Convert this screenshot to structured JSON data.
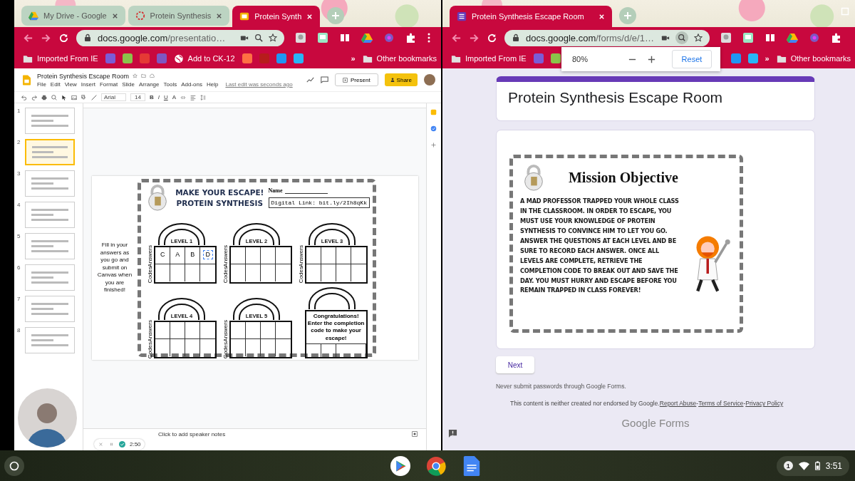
{
  "left_window": {
    "tabs": [
      {
        "title": "My Drive - Google",
        "selected": false
      },
      {
        "title": "Protein Synthesis",
        "selected": false
      },
      {
        "title": "Protein Synth",
        "selected": true
      }
    ],
    "url": {
      "host": "docs.google.com",
      "path": "/presentatio…"
    },
    "bookmarks": [
      {
        "kind": "folder",
        "label": "Imported From IE"
      },
      {
        "kind": "icon",
        "color": "#7b5cd6"
      },
      {
        "kind": "icon",
        "color": "#8bc34a"
      },
      {
        "kind": "icon",
        "color": "#e53935"
      },
      {
        "kind": "icon",
        "color": "#7e57c2"
      },
      {
        "kind": "globe",
        "label": "Add to CK-12"
      },
      {
        "kind": "icon",
        "color": "#ff7043"
      },
      {
        "kind": "icon",
        "color": "#b71c1c"
      },
      {
        "kind": "icon",
        "color": "#2196f3"
      },
      {
        "kind": "icon",
        "color": "#29b6f6"
      }
    ],
    "bookmarks_end": [
      {
        "kind": "overflow",
        "label": "»"
      },
      {
        "kind": "folder",
        "label": "Other bookmarks"
      }
    ]
  },
  "slides_app": {
    "doc_title": "Protein Synthesis Escape Room",
    "menus": [
      "File",
      "Edit",
      "View",
      "Insert",
      "Format",
      "Slide",
      "Arrange",
      "Tools",
      "Add-ons",
      "Help"
    ],
    "last_edit": "Last edit was seconds ago",
    "present": "Present",
    "share": "Share",
    "font": "Arial",
    "font_size": "14",
    "format_buttons": [
      "B",
      "I",
      "U",
      "A"
    ],
    "thumbnails": [
      {
        "number": "1",
        "selected": false
      },
      {
        "number": "2",
        "selected": true
      },
      {
        "number": "3",
        "selected": false
      },
      {
        "number": "4",
        "selected": false
      },
      {
        "number": "5",
        "selected": false
      },
      {
        "number": "6",
        "selected": false
      },
      {
        "number": "7",
        "selected": false
      },
      {
        "number": "8",
        "selected": false
      }
    ],
    "slide": {
      "side_note": "Fill in your answers as you go and submit on Canvas when you are finished!",
      "title_1": "MAKE YOUR ESCAPE!",
      "title_2": "PROTEIN SYNTHESIS",
      "name_label": "Name",
      "digital_link": "Digital Link: bit.ly/2Ih8qKk",
      "locks": [
        {
          "kind": "level",
          "title": "LEVEL 1",
          "row_labels": [
            "Answers",
            "Codes"
          ],
          "answers": [
            {
              "text": "C",
              "selected": false
            },
            {
              "text": "A",
              "selected": false
            },
            {
              "text": "B",
              "selected": false
            },
            {
              "text": "D",
              "selected": true
            }
          ]
        },
        {
          "kind": "level",
          "title": "LEVEL 2",
          "row_labels": [
            "Answers",
            "Codes"
          ]
        },
        {
          "kind": "level",
          "title": "LEVEL 3",
          "row_labels": [
            "Answers",
            "Codes"
          ]
        },
        {
          "kind": "level",
          "title": "LEVEL 4",
          "row_labels": [
            "Answers",
            "Codes"
          ]
        },
        {
          "kind": "level",
          "title": "LEVEL 5",
          "row_labels": [
            "Answers",
            "Codes"
          ]
        },
        {
          "kind": "final",
          "message": "Congratulations! Enter the completion code to make your escape!"
        }
      ]
    },
    "speaker_notes": "Click to add speaker notes"
  },
  "recording": {
    "timer": "2:50"
  },
  "right_window": {
    "tabs": [
      {
        "title": "Protein Synthesis Escape Room",
        "selected": true
      }
    ],
    "url": {
      "host": "docs.google.com",
      "path": "/forms/d/e/1…"
    },
    "bookmarks": [
      {
        "kind": "folder",
        "label": "Imported From IE"
      },
      {
        "kind": "icon",
        "color": "#7b5cd6"
      },
      {
        "kind": "icon",
        "color": "#8bc34a"
      }
    ],
    "bookmarks_end": [
      {
        "kind": "icon",
        "color": "#2196f3"
      },
      {
        "kind": "icon",
        "color": "#29b6f6"
      },
      {
        "kind": "overflow",
        "label": "»"
      },
      {
        "kind": "folder",
        "label": "Other bookmarks"
      }
    ],
    "zoom_popup": {
      "level": "80%",
      "reset": "Reset"
    }
  },
  "form": {
    "title": "Protein Synthesis Escape Room",
    "image": {
      "heading": "Mission Objective",
      "body": "A MAD PROFESSOR TRAPPED YOUR WHOLE CLASS IN THE CLASSROOM. IN ORDER TO ESCAPE, YOU MUST USE YOUR KNOWLEDGE OF PROTEIN SYNTHESIS TO CONVINCE HIM TO LET YOU GO. ANSWER THE QUESTIONS AT EACH LEVEL AND BE SURE TO RECORD EACH ANSWER. ONCE ALL LEVELS ARE COMPLETE, RETRIEVE THE COMPLETION CODE TO BREAK OUT AND SAVE THE DAY. YOU MUST HURRY AND ESCAPE BEFORE YOU REMAIN TRAPPED IN CLASS FOREVER!"
    },
    "next": "Next",
    "password_note": "Never submit passwords through Google Forms.",
    "disclaimer": "This content is neither created nor endorsed by Google.",
    "links": [
      "Report Abuse",
      "Terms of Service",
      "Privacy Policy"
    ],
    "separator": "-",
    "logo": "Google Forms"
  },
  "shelf": {
    "notifications": "1",
    "time": "3:51"
  }
}
